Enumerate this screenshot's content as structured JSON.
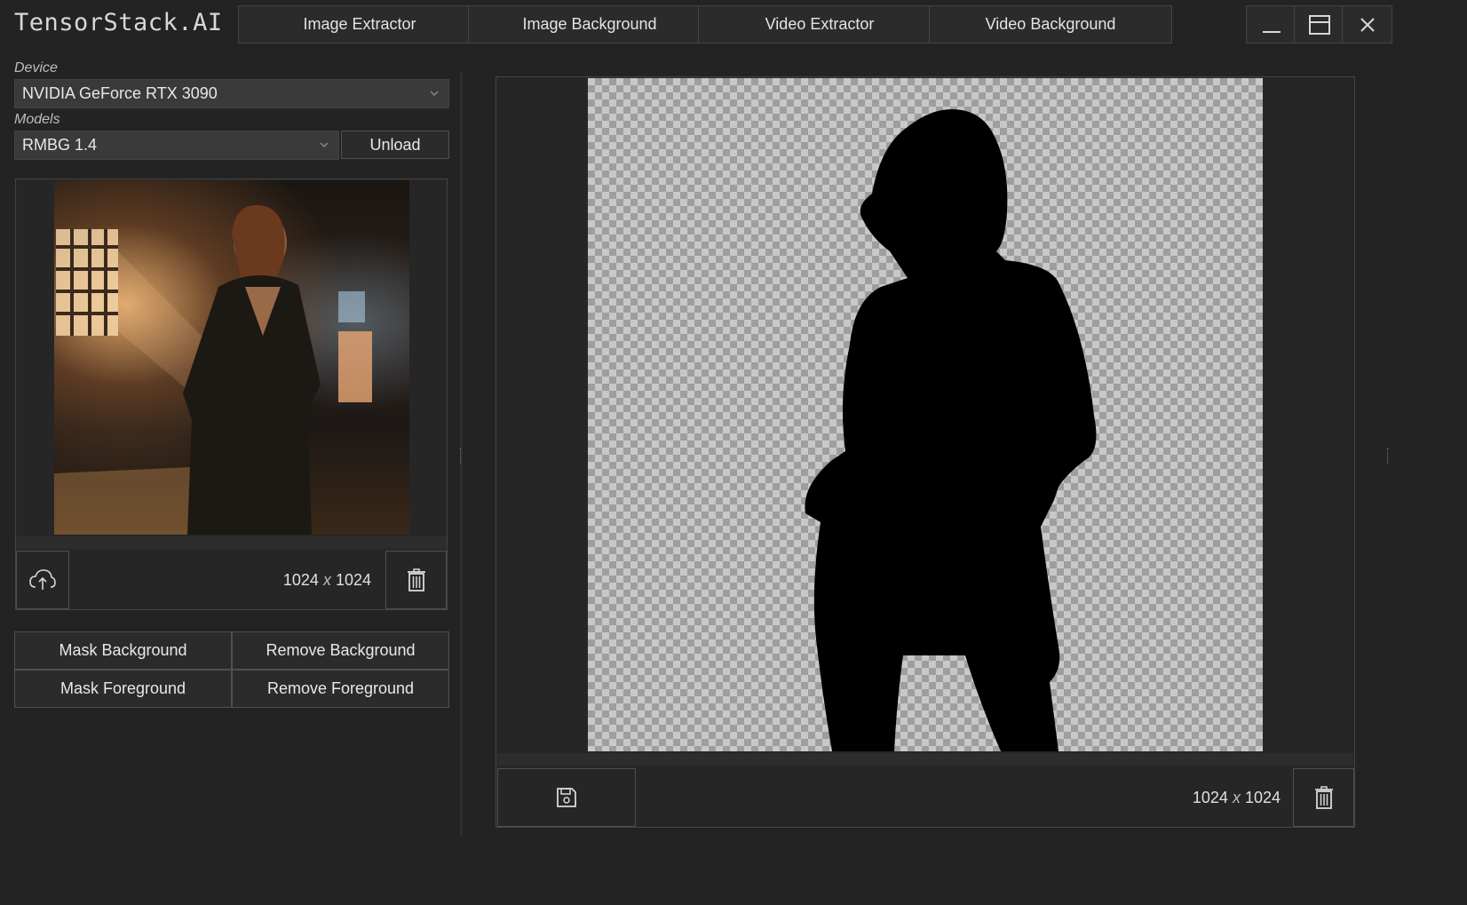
{
  "app": {
    "title": "TensorStack.AI",
    "tabs": [
      {
        "label": "Image Extractor"
      },
      {
        "label": "Image Background"
      },
      {
        "label": "Video Extractor"
      },
      {
        "label": "Video Background"
      }
    ],
    "window_controls": {
      "minimize_icon": "minimize-icon",
      "maximize_icon": "maximize-icon",
      "close_icon": "close-icon"
    }
  },
  "settings": {
    "device_label": "Device",
    "device_value": "NVIDIA GeForce RTX 3090",
    "models_label": "Models",
    "model_value": "RMBG 1.4",
    "unload_label": "Unload"
  },
  "input_image": {
    "size": {
      "w": "1024",
      "x": "x",
      "h": "1024"
    },
    "upload_icon": "cloud-upload-icon",
    "delete_icon": "trash-icon"
  },
  "actions": {
    "mask_background": "Mask Background",
    "remove_background": "Remove Background",
    "mask_foreground": "Mask Foreground",
    "remove_foreground": "Remove Foreground"
  },
  "output_image": {
    "size": {
      "w": "1024",
      "x": "x",
      "h": "1024"
    },
    "save_icon": "save-icon",
    "delete_icon": "trash-icon"
  },
  "colors": {
    "background": "#232323",
    "panel": "#262626",
    "button": "#2b2b2b",
    "select": "#3a3a3a",
    "border": "#444444"
  }
}
